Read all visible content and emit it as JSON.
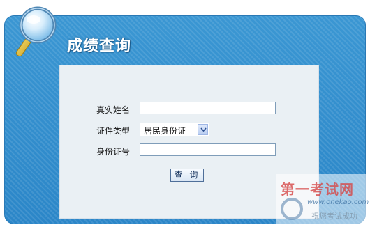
{
  "page": {
    "title": "成绩查询"
  },
  "form": {
    "name_label": "真实姓名",
    "name_value": "",
    "id_type_label": "证件类型",
    "id_type_selected": "居民身份证",
    "id_number_label": "身份证号",
    "id_number_value": "",
    "submit_label": "查 询"
  },
  "watermark": {
    "title": "第一考试网",
    "url": "www.onekao.com",
    "slogan": "祝您考试成功"
  },
  "colors": {
    "panel_blue": "#3b97d3",
    "form_background": "#eaf0f4",
    "watermark_red": "#d64747"
  }
}
